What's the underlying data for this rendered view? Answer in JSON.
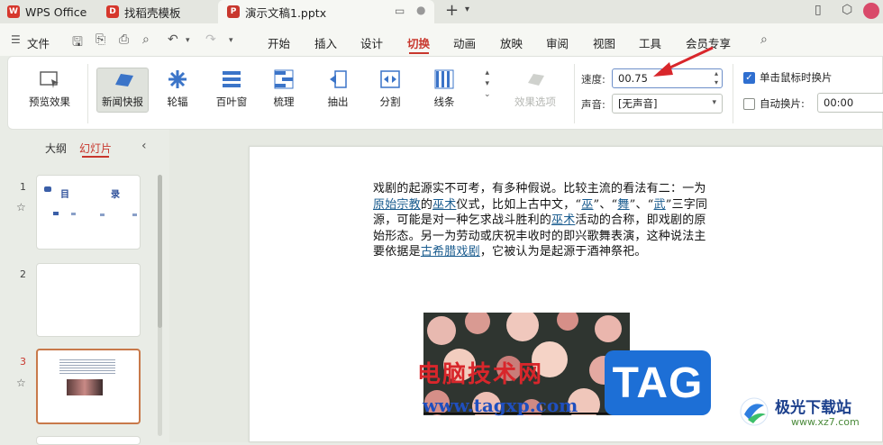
{
  "tabs": [
    {
      "label": "WPS Office",
      "icon": "wps-logo-icon"
    },
    {
      "label": "找稻壳模板",
      "icon": "docer-logo-icon"
    },
    {
      "label": "演示文稿1.pptx",
      "icon": "presentation-file-icon"
    }
  ],
  "menubar": {
    "file": "文件",
    "items": [
      "开始",
      "插入",
      "设计",
      "切换",
      "动画",
      "放映",
      "审阅",
      "视图",
      "工具",
      "会员专享"
    ],
    "active": "切换"
  },
  "ribbon": {
    "preview_label": "预览效果",
    "transitions": [
      "新闻快报",
      "轮辐",
      "百叶窗",
      "梳理",
      "抽出",
      "分割",
      "线条"
    ],
    "selected_transition": "新闻快报",
    "effect_options_label": "效果选项",
    "speed_label": "速度:",
    "speed_value": "00.75",
    "sound_label": "声音:",
    "sound_value": "[无声音]",
    "click_advance_label": "单击鼠标时换片",
    "auto_advance_label": "自动换片:",
    "auto_advance_value": "00:00"
  },
  "left_panel": {
    "tab_outline": "大纲",
    "tab_slides": "幻灯片",
    "slide_numbers": [
      "1",
      "2",
      "3"
    ],
    "slide1_title_a": "目",
    "slide1_title_b": "录"
  },
  "slide": {
    "paragraph": [
      {
        "t": "戏剧的起源实不可考，有多种假说。比较主流的看法有二：一为"
      },
      {
        "t": "原始宗教",
        "link": true
      },
      {
        "t": "的"
      },
      {
        "t": "巫术",
        "link": true
      },
      {
        "t": "仪式，比如上古中文，“"
      },
      {
        "t": "巫",
        "link": true
      },
      {
        "t": "”、“"
      },
      {
        "t": "舞",
        "link": true
      },
      {
        "t": "”、“"
      },
      {
        "t": "武",
        "link": true
      },
      {
        "t": "”三字同源，可能是对一种乞求战斗胜利的"
      },
      {
        "t": "巫术",
        "link": true
      },
      {
        "t": "活动的合称，即戏剧的原始形态。另一为劳动或庆祝丰收时的即兴歌舞表演，这种说法主要依据是"
      },
      {
        "t": "古希腊戏剧",
        "link": true
      },
      {
        "t": "，它被认为是起源于酒神祭祀。"
      }
    ],
    "watermark_text": "电脑技术网",
    "watermark_url": "www.tagxp.com",
    "tag_badge": "TAG"
  },
  "corner_logo": {
    "name": "极光下载站",
    "url": "www.xz7.com"
  },
  "colors": {
    "accent": "#c8372d",
    "link": "#1a5c8f",
    "tag_blue": "#1d6fd6"
  }
}
